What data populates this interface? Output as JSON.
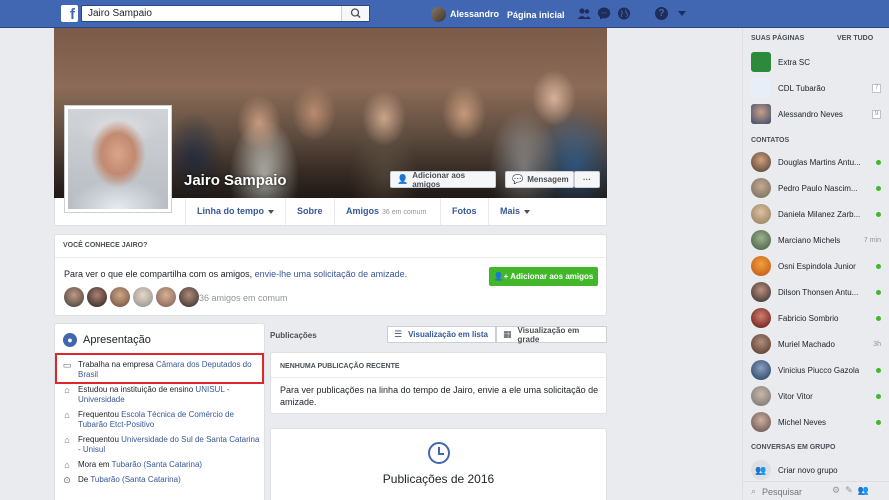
{
  "topbar": {
    "search_value": "Jairo Sampaio",
    "user_name": "Alessandro",
    "home_label": "Página inicial",
    "accent": "#4267b2"
  },
  "profile": {
    "name": "Jairo Sampaio",
    "add_friend_label": "Adicionar aos amigos",
    "message_label": "Mensagem",
    "more_label": "···"
  },
  "profile_nav": {
    "timeline": "Linha do tempo",
    "about": "Sobre",
    "friends": "Amigos",
    "friends_count": "36 em comum",
    "photos": "Fotos",
    "more": "Mais"
  },
  "know": {
    "title": "VOCÊ CONHECE JAIRO?",
    "text": "Para ver o que ele compartilha com os amigos, ",
    "link": "envie-lhe uma solicitação de amizade.",
    "button": "Adicionar aos amigos",
    "mutual": "36 amigos em comum"
  },
  "intro": {
    "title": "Apresentação",
    "items": [
      {
        "icon": "briefcase-icon",
        "prefix": "Trabalha na empresa ",
        "link": "Câmara dos Deputados do Brasil"
      },
      {
        "icon": "graduation-cap-icon",
        "prefix": "Estudou na instituição de ensino ",
        "link": "UNISUL - Universidade"
      },
      {
        "icon": "graduation-cap-icon",
        "prefix": "Frequentou ",
        "link": "Escola Técnica de Comércio de Tubarão Etct-Positivo"
      },
      {
        "icon": "graduation-cap-icon",
        "prefix": "Frequentou ",
        "link": "Universidade do Sul de Santa Catarina - Unisul"
      },
      {
        "icon": "home-icon",
        "prefix": "Mora em ",
        "link": "Tubarão (Santa Catarina)"
      },
      {
        "icon": "location-pin-icon",
        "prefix": "De ",
        "link": "Tubarão (Santa Catarina)"
      }
    ]
  },
  "posts": {
    "label": "Publicações",
    "list_view": "Visualização em lista",
    "grid_view": "Visualização em grade",
    "none_title": "NENHUMA PUBLICAÇÃO RECENTE",
    "none_text": "Para ver publicações na linha do tempo de Jairo, envie a ele uma solicitação de amizade.",
    "year_title": "Publicações de 2016"
  },
  "sidebar": {
    "pages_title": "SUAS PÁGINAS",
    "see_all": "VER TUDO",
    "pages": [
      {
        "name": "Extra SC",
        "badge": ""
      },
      {
        "name": "CDL Tubarão",
        "badge": "7"
      },
      {
        "name": "Alessandro Neves",
        "badge": "9"
      }
    ],
    "contacts_title": "CONTATOS",
    "contacts": [
      {
        "name": "Douglas Martins Antu...",
        "status": "online",
        "time": ""
      },
      {
        "name": "Pedro Paulo Nascim...",
        "status": "online",
        "time": ""
      },
      {
        "name": "Daniela Milanez Zarb...",
        "status": "online",
        "time": ""
      },
      {
        "name": "Marciano Michels",
        "status": "idle",
        "time": "7 min"
      },
      {
        "name": "Osni Espindola Junior",
        "status": "online",
        "time": ""
      },
      {
        "name": "Dilson Thonsen Antu...",
        "status": "online",
        "time": ""
      },
      {
        "name": "Fabricio Sombrio",
        "status": "online",
        "time": ""
      },
      {
        "name": "Muriel Machado",
        "status": "idle",
        "time": "3h"
      },
      {
        "name": "Vinicius Piucco Gazola",
        "status": "online",
        "time": ""
      },
      {
        "name": "Vitor Vitor",
        "status": "online",
        "time": ""
      },
      {
        "name": "Michel Neves",
        "status": "online",
        "time": ""
      }
    ],
    "groups_title": "CONVERSAS EM GRUPO",
    "new_group": "Criar novo grupo",
    "search_placeholder": "Pesquisar"
  }
}
